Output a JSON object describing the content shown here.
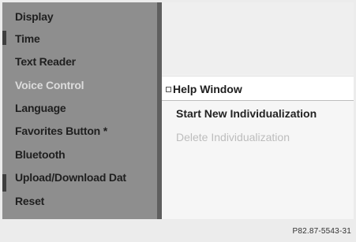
{
  "menu": {
    "items": [
      {
        "label": "Display",
        "selected": false
      },
      {
        "label": "Time",
        "selected": false
      },
      {
        "label": "Text Reader",
        "selected": false
      },
      {
        "label": "Voice Control",
        "selected": true
      },
      {
        "label": "Language",
        "selected": false
      },
      {
        "label": "Favorites Button *",
        "selected": false
      },
      {
        "label": "Bluetooth",
        "selected": false
      },
      {
        "label": "Upload/Download Dat",
        "selected": false
      },
      {
        "label": "Reset",
        "selected": false
      }
    ]
  },
  "submenu": {
    "help_window": {
      "label": "Help Window",
      "checked": true
    },
    "start_new_individualization": {
      "label": "Start New Individualization",
      "enabled": true
    },
    "delete_individualization": {
      "label": "Delete Individualization",
      "enabled": false
    }
  },
  "image_code": "P82.87-5543-31",
  "colors": {
    "menu_background": "#8e8e8e",
    "selected_text": "#dcdcdc",
    "disabled_text": "#bdbdbd"
  }
}
